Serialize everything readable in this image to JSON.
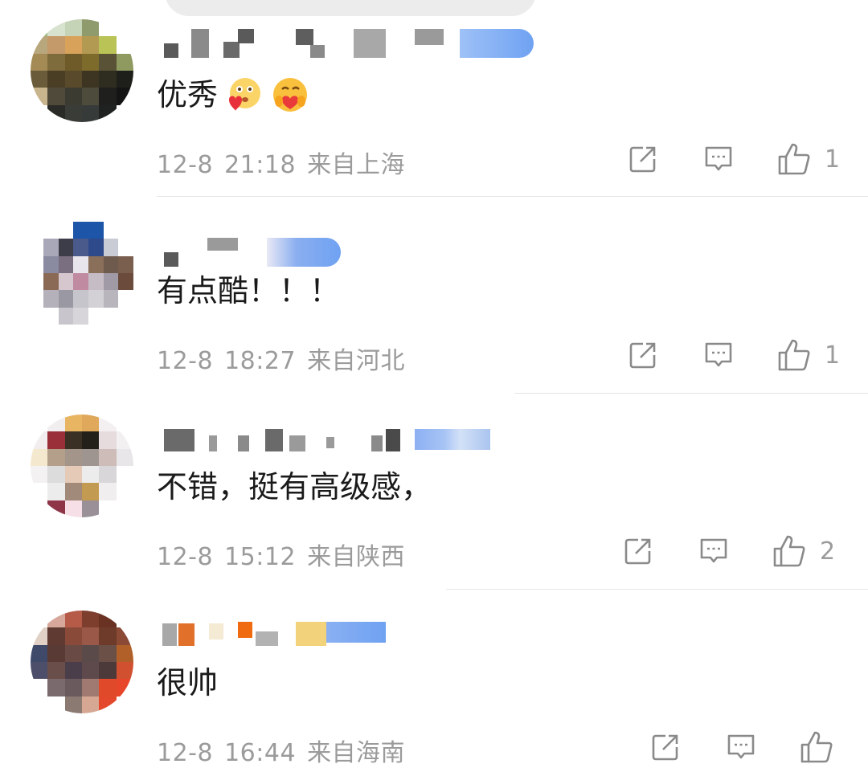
{
  "comments": [
    {
      "text": "优秀",
      "emojis": [
        "heart-face-emoji",
        "hug-face-emoji"
      ],
      "date": "12-8",
      "time": "21:18",
      "location": "来自上海",
      "likes": "1"
    },
    {
      "text": "有点酷！！！",
      "date": "12-8",
      "time": "18:27",
      "location": "来自河北",
      "likes": "1"
    },
    {
      "text": "不错，挺有高级感，",
      "date": "12-8",
      "time": "15:12",
      "location": "来自陕西",
      "likes": "2"
    },
    {
      "text": "很帅",
      "date": "12-8",
      "time": "16:44",
      "location": "来自海南",
      "likes": ""
    }
  ],
  "colors": {
    "meta_gray": "#9b9b9b",
    "badge_blue": "#6fa2f2",
    "divider": "#e6e6e6",
    "icon_gray": "#8a8a8a"
  },
  "icons": [
    "share-icon",
    "reply-icon",
    "like-icon"
  ]
}
